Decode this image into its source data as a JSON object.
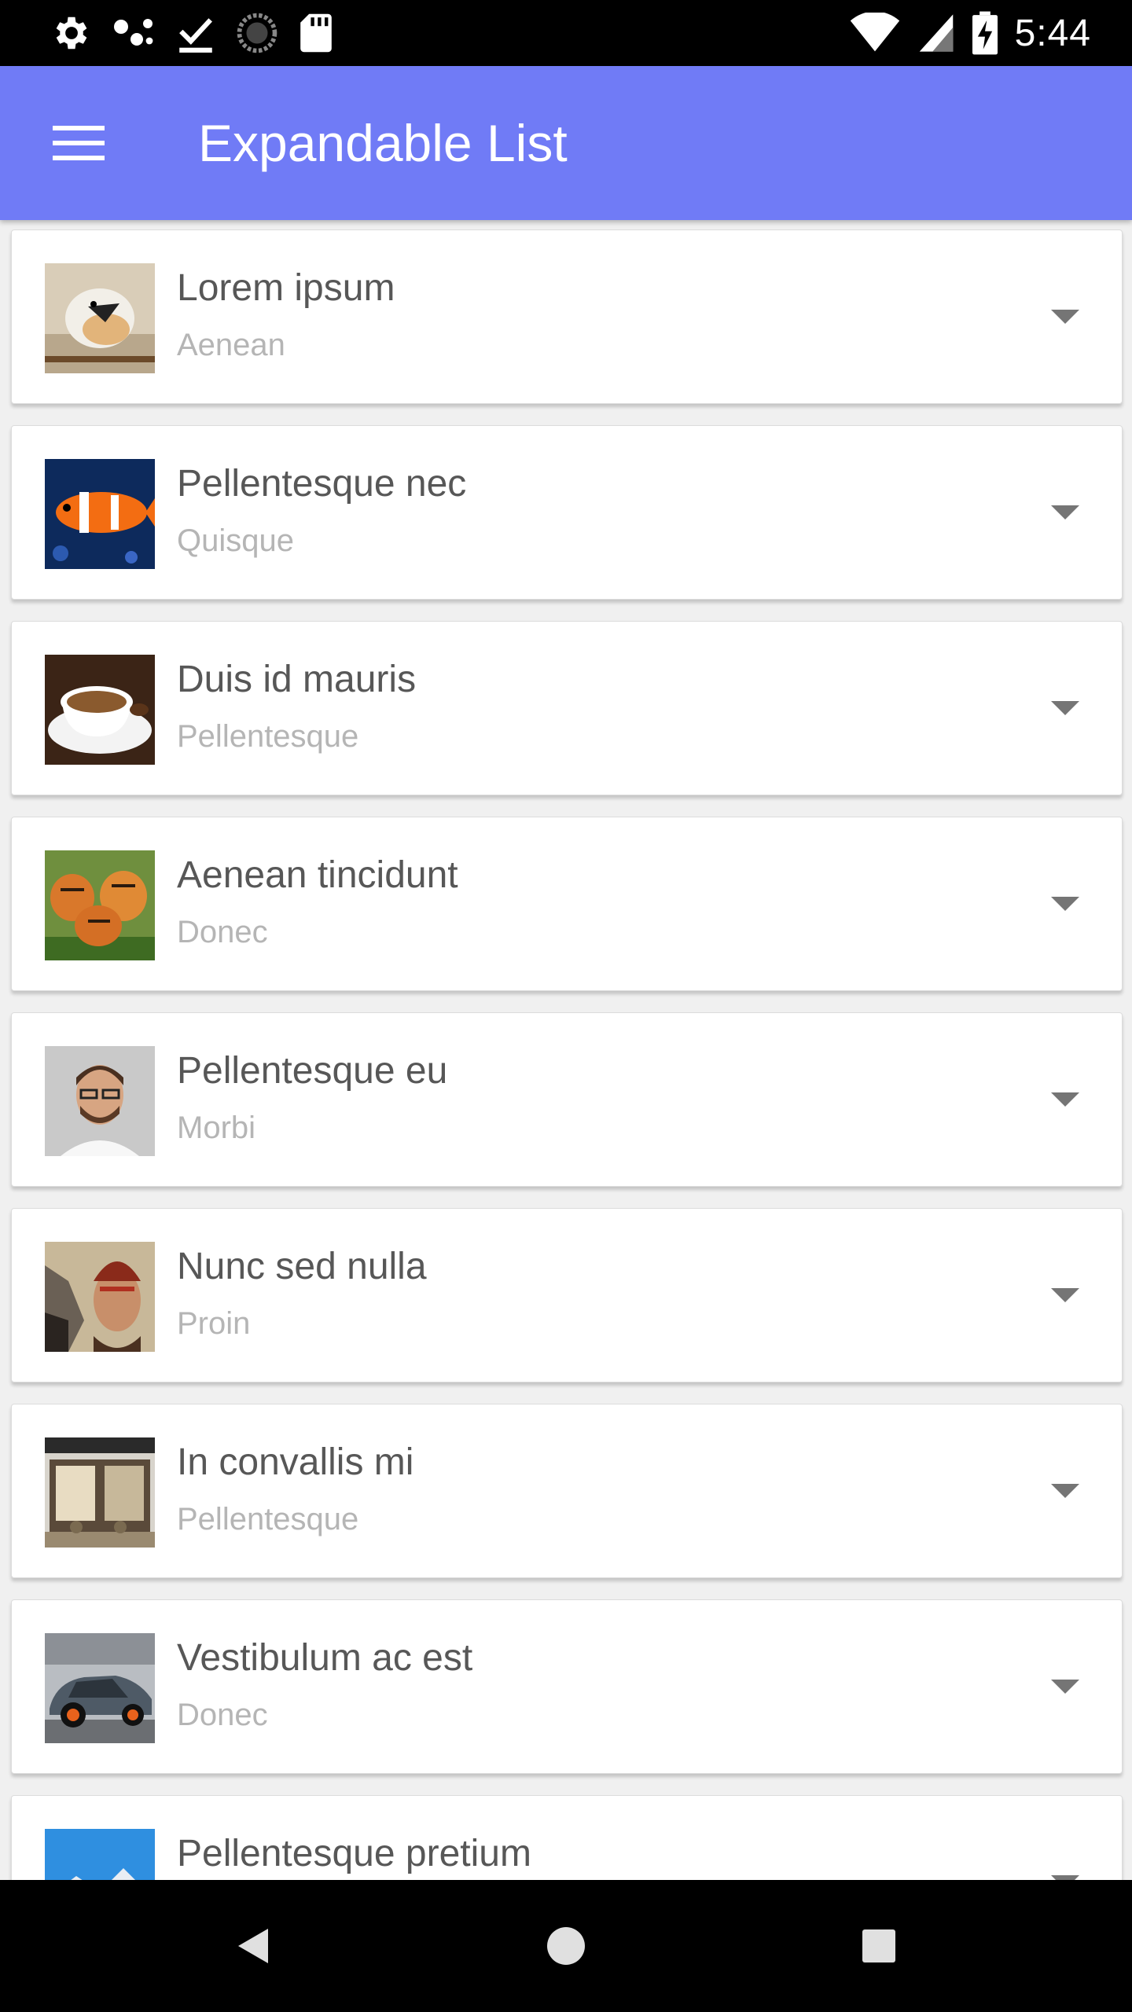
{
  "status_bar": {
    "time": "5:44",
    "left_icons": [
      "settings-icon",
      "dots-icon",
      "download-done-icon",
      "progress-icon",
      "sd-card-icon"
    ],
    "right_icons": [
      "wifi-icon",
      "signal-icon",
      "battery-charging-icon"
    ]
  },
  "app_bar": {
    "title": "Expandable List",
    "menu_icon": "hamburger-menu-icon",
    "color": "#707bf6"
  },
  "list": {
    "items": [
      {
        "title": "Lorem ipsum",
        "subtitle": "Aenean",
        "thumbnail": "bird-photo"
      },
      {
        "title": "Pellentesque nec",
        "subtitle": "Quisque",
        "thumbnail": "clownfish-photo"
      },
      {
        "title": "Duis id mauris",
        "subtitle": "Pellentesque",
        "thumbnail": "coffee-photo"
      },
      {
        "title": "Aenean tincidunt",
        "subtitle": "Donec",
        "thumbnail": "tiger-cubs-photo"
      },
      {
        "title": "Pellentesque eu",
        "subtitle": "Morbi",
        "thumbnail": "man-portrait-photo"
      },
      {
        "title": "Nunc sed nulla",
        "subtitle": "Proin",
        "thumbnail": "wolf-woman-art"
      },
      {
        "title": "In convallis mi",
        "subtitle": "Pellentesque",
        "thumbnail": "storefront-photo"
      },
      {
        "title": "Vestibulum ac est",
        "subtitle": "Donec",
        "thumbnail": "sports-car-photo"
      },
      {
        "title": "Pellentesque pretium",
        "subtitle": "",
        "thumbnail": "mountain-photo"
      }
    ]
  },
  "nav_bar": {
    "buttons": [
      "back-icon",
      "home-icon",
      "recents-icon"
    ]
  }
}
